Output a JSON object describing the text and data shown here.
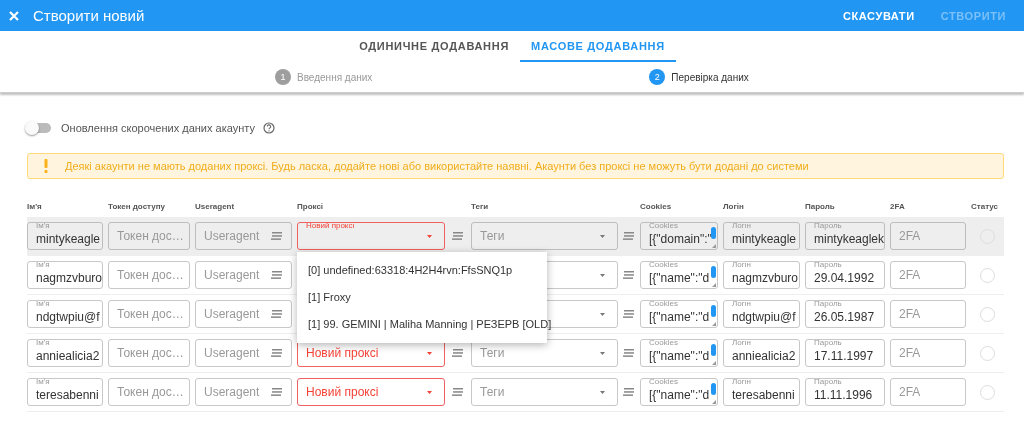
{
  "window": {
    "title": "Створити новий",
    "actions": [
      {
        "label": "СКАСУВАТИ",
        "disabled": false
      },
      {
        "label": "СТВОРИТИ",
        "disabled": true
      }
    ]
  },
  "tabs": [
    {
      "label": "ОДИНИЧНЕ ДОДАВАННЯ",
      "selected": false
    },
    {
      "label": "МАСОВЕ ДОДАВАННЯ",
      "selected": true
    }
  ],
  "steps": [
    {
      "number": "1",
      "label": "Введення даних",
      "active": false
    },
    {
      "number": "2",
      "label": "Перевірка даних",
      "active": true
    }
  ],
  "toggle": {
    "label": "Оновлення скорочених даних акаунту",
    "on": false
  },
  "alert": {
    "text": "Деякі акаунти не мають доданих проксі. Будь ласка, додайте нові або використайте наявні. Акаунти без проксі не можуть бути додані до системи"
  },
  "table": {
    "columns": [
      "Ім'я",
      "Токен доступу",
      "Useragent",
      "Проксі",
      "Теги",
      "Cookies",
      "Логін",
      "Пароль",
      "2FA",
      "Статус"
    ],
    "rows": [
      {
        "highlighted": true,
        "name_label": "Ім'я",
        "name": "mintykeagle",
        "token": "Токен дос…",
        "useragent": "Useragent",
        "proxy": {
          "label": "Новий проксі",
          "error": true,
          "options": [
            "[0] undefined:63318:4H2H4rvn:FfsSNQ1p",
            "[1] Froxy",
            "[1] 99. GEMINI | Maliha Manning | РЕЗЕРВ [OLD]"
          ]
        },
        "tags": "Теги",
        "cookies_label": "Cookies",
        "cookies": "[{\"domain\":\"",
        "login_label": "Логін",
        "login": "mintykeagle",
        "password_label": "Пароль",
        "password": "mintykeaglek",
        "twofa": "2FA"
      },
      {
        "highlighted": false,
        "name_label": "Ім'я",
        "name": "nagmzvburo",
        "token": "Токен дос…",
        "useragent": "Useragent",
        "cookies_label": "Cookies",
        "cookies": "[{\"name\":\"d",
        "login_label": "Логін",
        "login": "nagmzvburo",
        "password_label": "Пароль",
        "password": "29.04.1992",
        "twofa": "2FA"
      },
      {
        "highlighted": false,
        "name_label": "Ім'я",
        "name": "ndgtwpiu@f",
        "token": "Токен дос…",
        "useragent": "Useragent",
        "cookies_label": "Cookies",
        "cookies": "[{\"name\":\"d",
        "login_label": "Логін",
        "login": "ndgtwpiu@f",
        "password_label": "Пароль",
        "password": "26.05.1987",
        "twofa": "2FA"
      },
      {
        "highlighted": false,
        "name_label": "Ім'я",
        "name": "anniealicia2",
        "token": "Токен дос…",
        "useragent": "Useragent",
        "proxy": {
          "placeholder": "Новий проксі",
          "error": true
        },
        "tags": "Теги",
        "cookies_label": "Cookies",
        "cookies": "[{\"name\":\"d",
        "login_label": "Логін",
        "login": "anniealicia2",
        "password_label": "Пароль",
        "password": "17.11.1997",
        "twofa": "2FA"
      },
      {
        "highlighted": false,
        "name_label": "Ім'я",
        "name": "teresabenni",
        "token": "Токен дос…",
        "useragent": "Useragent",
        "proxy": {
          "placeholder": "Новий проксі",
          "error": true
        },
        "tags": "Теги",
        "cookies_label": "Cookies",
        "cookies": "[{\"name\":\"d",
        "login_label": "Логін",
        "login": "teresabenni",
        "password_label": "Пароль",
        "password": "11.11.1996",
        "twofa": "2FA"
      }
    ]
  }
}
